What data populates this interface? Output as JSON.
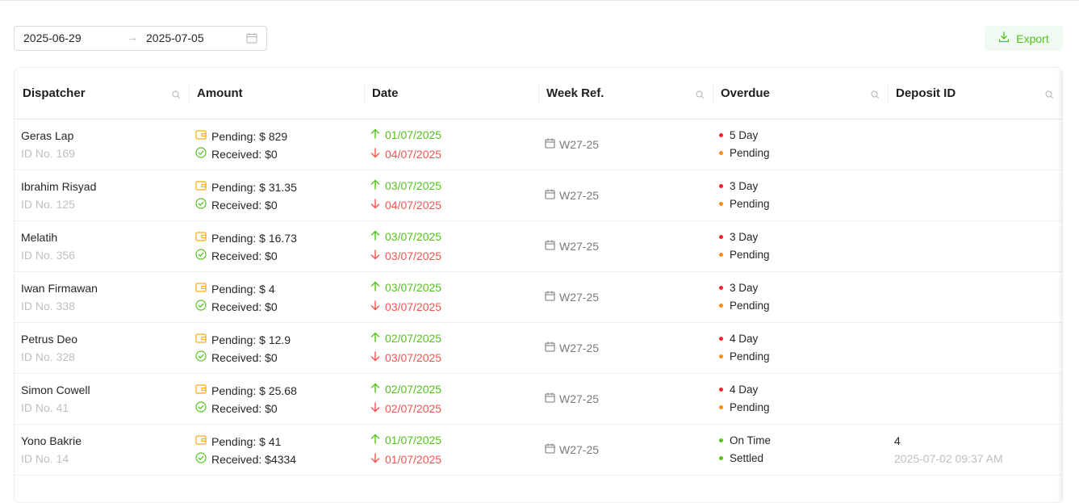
{
  "date_range": {
    "start": "2025-06-29",
    "separator": "→",
    "end": "2025-07-05"
  },
  "toolbar": {
    "export_label": "Export"
  },
  "table": {
    "columns": [
      "Dispatcher",
      "Amount",
      "Date",
      "Week Ref.",
      "Overdue",
      "Deposit ID"
    ],
    "rows": [
      {
        "name": "Geras Lap",
        "id_no": "ID No. 169",
        "pending": "Pending: $ 829",
        "received": "Received: $0",
        "date_up": "01/07/2025",
        "date_down": "04/07/2025",
        "week": "W27-25",
        "overdue": "5 Day",
        "overdue_color": "#f5222d",
        "status": "Pending",
        "status_color": "#fa8c16",
        "deposit_id": "",
        "deposit_time": ""
      },
      {
        "name": "Ibrahim Risyad",
        "id_no": "ID No. 125",
        "pending": "Pending: $ 31.35",
        "received": "Received: $0",
        "date_up": "03/07/2025",
        "date_down": "04/07/2025",
        "week": "W27-25",
        "overdue": "3 Day",
        "overdue_color": "#f5222d",
        "status": "Pending",
        "status_color": "#fa8c16",
        "deposit_id": "",
        "deposit_time": ""
      },
      {
        "name": "Melatih",
        "id_no": "ID No. 356",
        "pending": "Pending: $ 16.73",
        "received": "Received: $0",
        "date_up": "03/07/2025",
        "date_down": "03/07/2025",
        "week": "W27-25",
        "overdue": "3 Day",
        "overdue_color": "#f5222d",
        "status": "Pending",
        "status_color": "#fa8c16",
        "deposit_id": "",
        "deposit_time": ""
      },
      {
        "name": "Iwan Firmawan",
        "id_no": "ID No. 338",
        "pending": "Pending: $ 4",
        "received": "Received: $0",
        "date_up": "03/07/2025",
        "date_down": "03/07/2025",
        "week": "W27-25",
        "overdue": "3 Day",
        "overdue_color": "#f5222d",
        "status": "Pending",
        "status_color": "#fa8c16",
        "deposit_id": "",
        "deposit_time": ""
      },
      {
        "name": "Petrus Deo",
        "id_no": "ID No. 328",
        "pending": "Pending: $ 12.9",
        "received": "Received: $0",
        "date_up": "02/07/2025",
        "date_down": "03/07/2025",
        "week": "W27-25",
        "overdue": "4 Day",
        "overdue_color": "#f5222d",
        "status": "Pending",
        "status_color": "#fa8c16",
        "deposit_id": "",
        "deposit_time": ""
      },
      {
        "name": "Simon Cowell",
        "id_no": "ID No. 41",
        "pending": "Pending: $ 25.68",
        "received": "Received: $0",
        "date_up": "02/07/2025",
        "date_down": "02/07/2025",
        "week": "W27-25",
        "overdue": "4 Day",
        "overdue_color": "#f5222d",
        "status": "Pending",
        "status_color": "#fa8c16",
        "deposit_id": "",
        "deposit_time": ""
      },
      {
        "name": "Yono Bakrie",
        "id_no": "ID No. 14",
        "pending": "Pending: $ 41",
        "received": "Received: $4334",
        "date_up": "01/07/2025",
        "date_down": "01/07/2025",
        "week": "W27-25",
        "overdue": "On Time",
        "overdue_color": "#52c41a",
        "status": "Settled",
        "status_color": "#52c41a",
        "deposit_id": "4",
        "deposit_time": "2025-07-02 09:37 AM"
      }
    ]
  }
}
